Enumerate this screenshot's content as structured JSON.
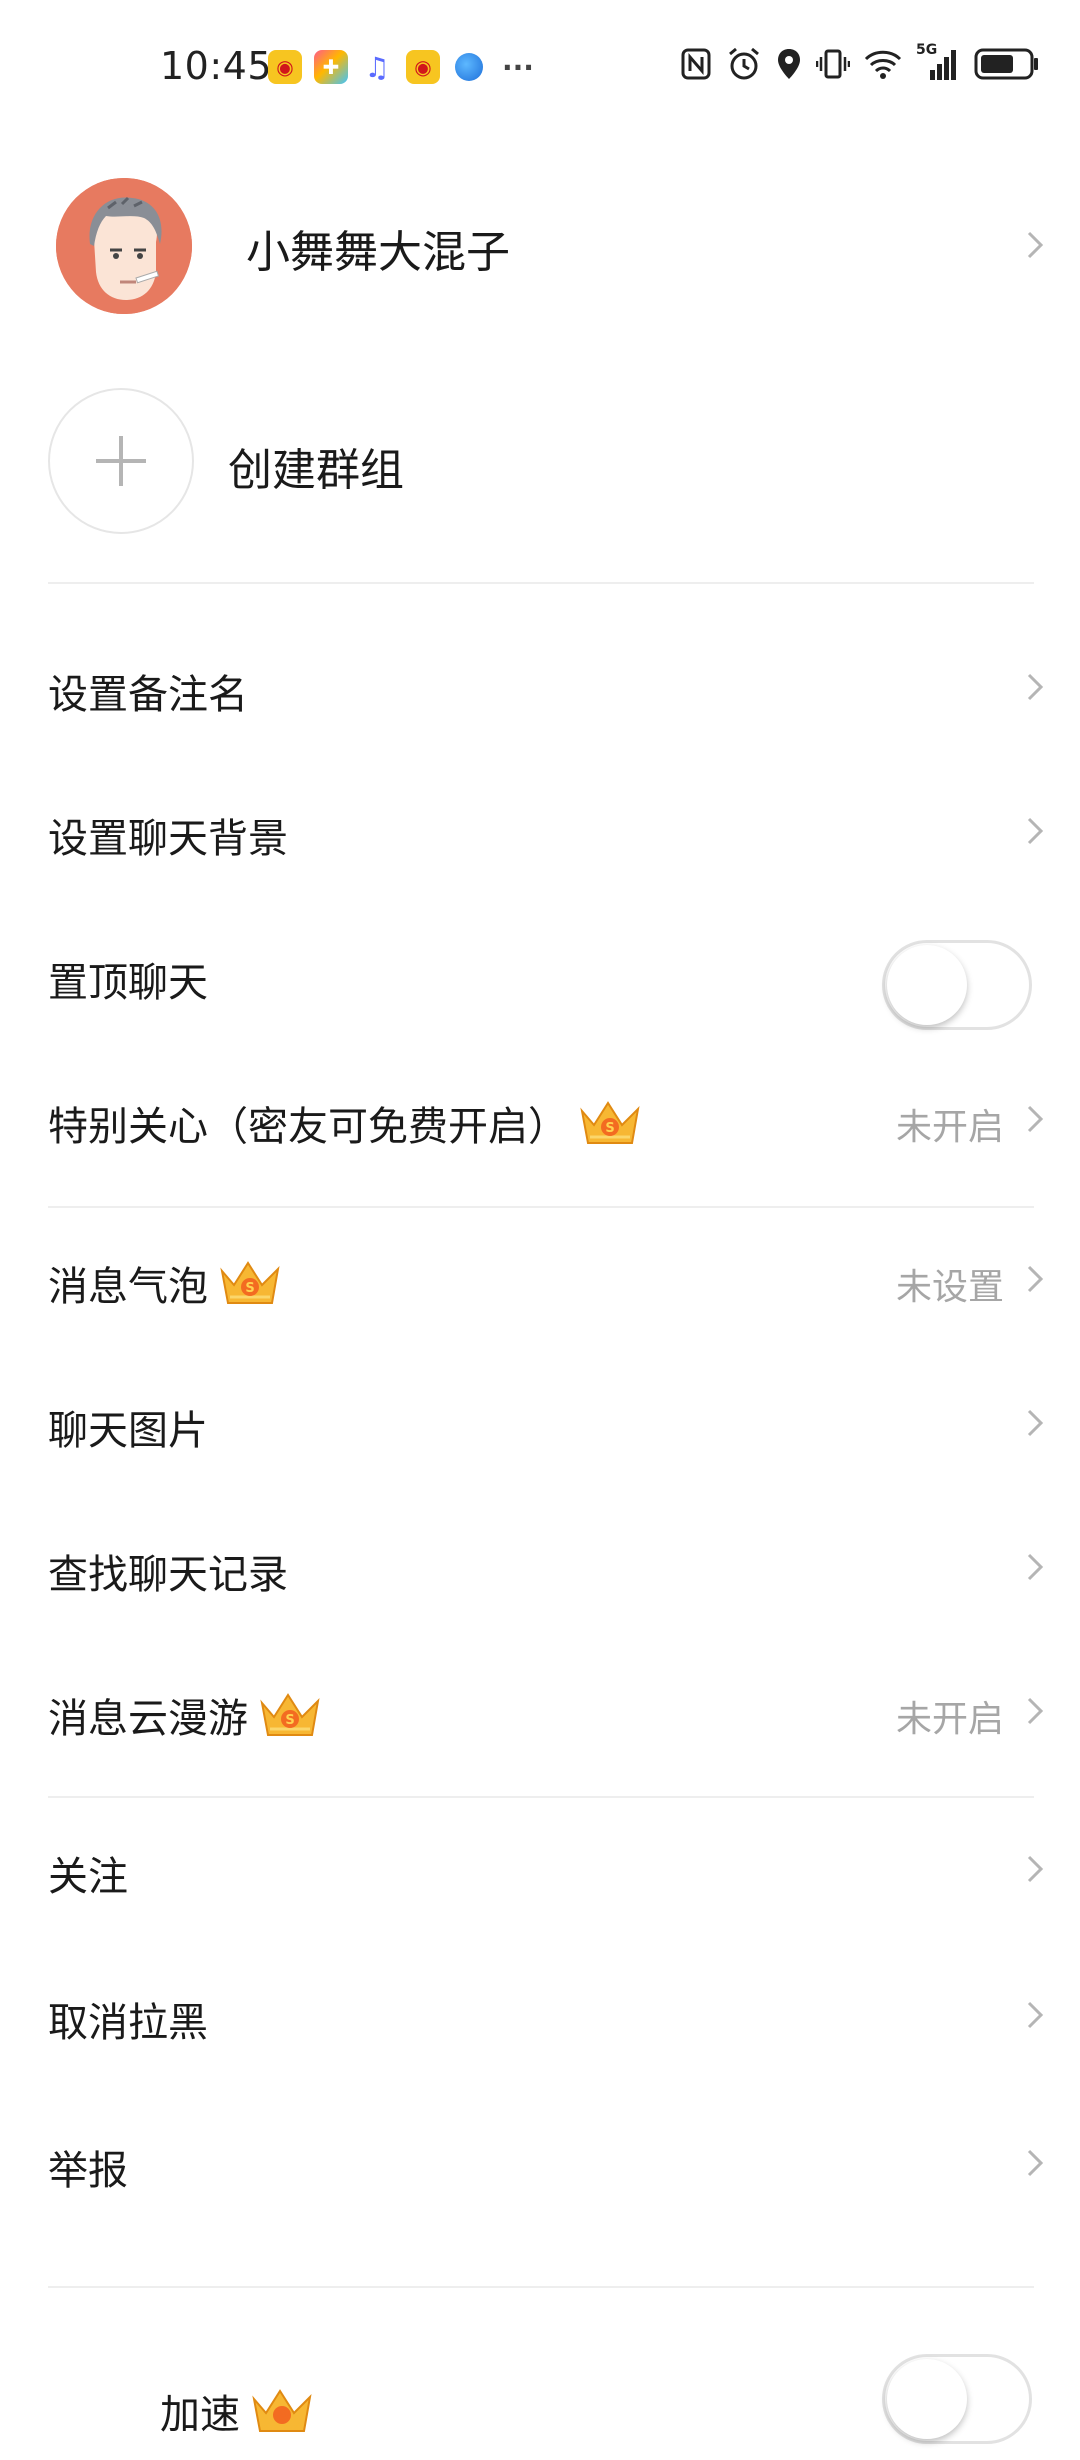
{
  "status_bar": {
    "time": "10:45",
    "more_indicator": "···",
    "network": "5G",
    "notification_icons": [
      "weibo-icon",
      "app-icon",
      "music-icon",
      "weibo-icon",
      "browser-icon"
    ],
    "system_icons": [
      "nfc-icon",
      "alarm-icon",
      "location-icon",
      "vibrate-icon",
      "wifi-icon",
      "signal-icon",
      "battery-icon"
    ]
  },
  "profile": {
    "name": "小舞舞大混子"
  },
  "create_group": {
    "label": "创建群组"
  },
  "settings": {
    "remark_name": {
      "label": "设置备注名"
    },
    "chat_background": {
      "label": "设置聊天背景"
    },
    "pin_chat": {
      "label": "置顶聊天",
      "enabled": false
    },
    "special_care": {
      "label": "特别关心（密友可免费开启）",
      "value": "未开启"
    },
    "message_bubble": {
      "label": "消息气泡",
      "value": "未设置"
    },
    "chat_images": {
      "label": "聊天图片"
    },
    "search_history": {
      "label": "查找聊天记录"
    },
    "cloud_roaming": {
      "label": "消息云漫游",
      "value": "未开启"
    },
    "follow": {
      "label": "关注"
    },
    "unblock": {
      "label": "取消拉黑"
    },
    "report": {
      "label": "举报"
    },
    "partial_item": {
      "label": "加速",
      "enabled": false
    }
  },
  "colors": {
    "background": "#ffffff",
    "divider": "#eeeeee",
    "secondary_text": "#a6a6a6",
    "avatar_bg": "#e77a60",
    "vip_crown": "#f5a623"
  }
}
